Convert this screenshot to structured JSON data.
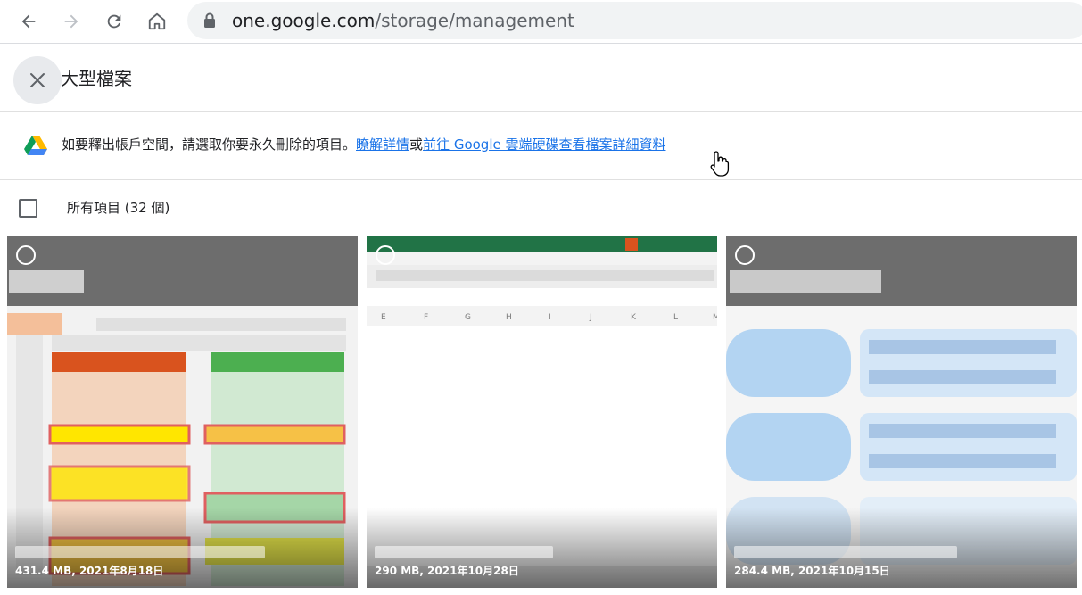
{
  "browser": {
    "url_host": "one.google.com",
    "url_path": "/storage/management",
    "back_icon": "arrow-left-icon",
    "forward_icon": "arrow-right-icon",
    "reload_icon": "reload-icon",
    "home_icon": "home-icon"
  },
  "header": {
    "title": "大型檔案",
    "close_icon": "close-icon"
  },
  "notice": {
    "text": "如要釋出帳戶空間，請選取你要永久刪除的項目。",
    "link1": "瞭解詳情",
    "separator": "或",
    "link2": "前往 Google 雲端硬碟查看檔案詳細資料"
  },
  "selection": {
    "select_all_label": "所有項目 (32 個)"
  },
  "files": [
    {
      "meta": "431.4 MB, 2021年8月18日"
    },
    {
      "meta": "290 MB, 2021年10月28日"
    },
    {
      "meta": "284.4 MB, 2021年10月15日"
    }
  ],
  "colors": {
    "link": "#1a73e8",
    "excel_green": "#217346",
    "orange": "#d9531e",
    "green": "#4caf50",
    "light_blue": "#b3d4f2"
  }
}
